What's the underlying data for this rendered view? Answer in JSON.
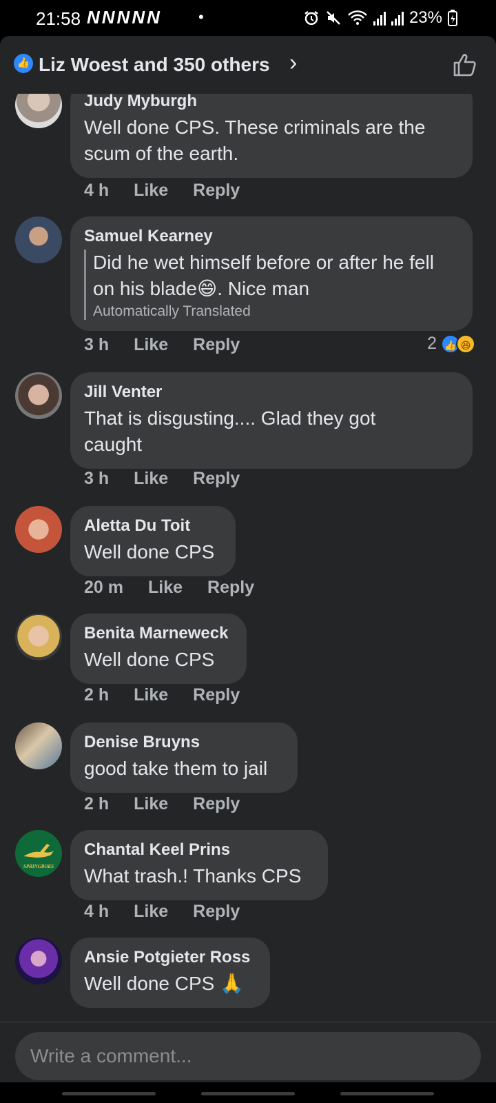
{
  "status_bar": {
    "time": "21:58",
    "notifications": "NNNNN",
    "dot": "•",
    "battery": "23%"
  },
  "header": {
    "reactions_summary": "Liz Woest and 350 others",
    "chevron": "›",
    "like_icon": "thumbs-up-outline",
    "accent_color": "#2d88ff"
  },
  "comments": [
    {
      "author": "Judy Myburgh",
      "text": "Well done CPS. These criminals are the scum of the earth.",
      "time": "4 h",
      "like": "Like",
      "reply": "Reply"
    },
    {
      "author": "Samuel Kearney",
      "text": "Did he wet himself before or after he fell on his blade😄. Nice man",
      "translated_note": "Automatically Translated",
      "time": "3 h",
      "like": "Like",
      "reply": "Reply",
      "reaction_count": "2"
    },
    {
      "author": "Jill Venter",
      "text": "That is disgusting.... Glad they got caught",
      "time": "3 h",
      "like": "Like",
      "reply": "Reply"
    },
    {
      "author": "Aletta Du Toit",
      "text": "Well done CPS",
      "time": "20 m",
      "like": "Like",
      "reply": "Reply"
    },
    {
      "author": "Benita Marneweck",
      "text": "Well done CPS",
      "time": "2 h",
      "like": "Like",
      "reply": "Reply"
    },
    {
      "author": "Denise Bruyns",
      "text": "good take them to jail",
      "time": "2 h",
      "like": "Like",
      "reply": "Reply"
    },
    {
      "author": "Chantal Keel Prins",
      "text": "What trash.! Thanks CPS",
      "time": "4 h",
      "like": "Like",
      "reply": "Reply",
      "avatar_logo": "SPRINGBOKS"
    },
    {
      "author": "Ansie Potgieter Ross",
      "text": "Well done CPS 🙏",
      "time": "",
      "like": "",
      "reply": ""
    }
  ],
  "composer": {
    "placeholder": "Write a comment..."
  }
}
